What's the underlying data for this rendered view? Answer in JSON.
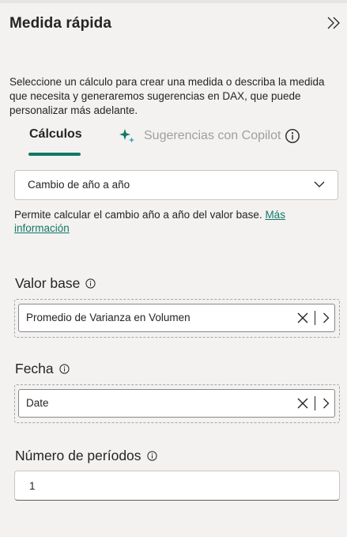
{
  "panel": {
    "title": "Medida rápida",
    "collapse_icon": "double-chevron-right-icon"
  },
  "description": "Seleccione un cálculo para crear una medida o describa la medida que necesita y generaremos sugerencias en DAX, que puede personalizar más adelante.",
  "tabs": {
    "calculos": "Cálculos",
    "copilot": "Sugerencias con Copilot",
    "active": "calculos",
    "accent_color": "#117865",
    "copilot_icon": "copilot-sparkle-icon"
  },
  "calculation": {
    "selected": "Cambio de año a año",
    "hint": "Permite calcular el cambio año a año del valor base.",
    "link": "Más información"
  },
  "fields": {
    "base_value": {
      "label": "Valor base",
      "value": "Promedio de Varianza en Volumen"
    },
    "date": {
      "label": "Fecha",
      "value": "Date"
    },
    "periods": {
      "label": "Número de períodos",
      "value": "1"
    }
  }
}
